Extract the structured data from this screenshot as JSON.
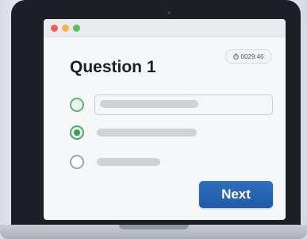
{
  "window": {
    "controls": [
      "close",
      "minimize",
      "maximize"
    ]
  },
  "quiz": {
    "question_title": "Question 1",
    "timer": "0029:46",
    "timer_icon": "stopwatch-icon",
    "options": [
      {
        "state": "highlighted",
        "text": ""
      },
      {
        "state": "selected",
        "text": ""
      },
      {
        "state": "unselected",
        "text": ""
      }
    ],
    "next_label": "Next"
  },
  "colors": {
    "accent": "#2a67b6",
    "radio_green": "#4fa863",
    "window_bg": "#f6f7f9",
    "laptop_bezel": "#1c1f24"
  }
}
